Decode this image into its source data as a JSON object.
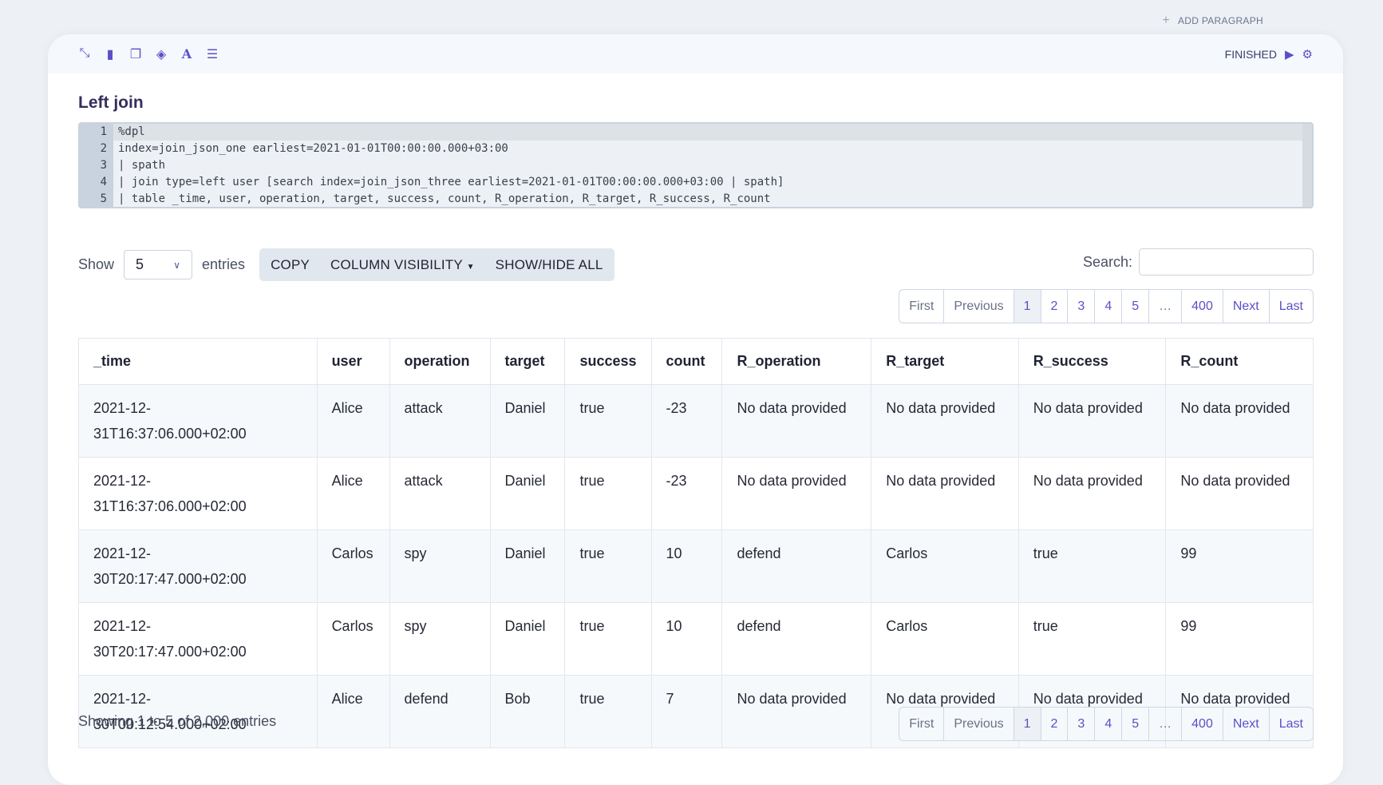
{
  "add_paragraph": "ADD PARAGRAPH",
  "toolbar": {
    "icons": [
      "compress-icon",
      "book-icon",
      "copy-icon",
      "eraser-icon",
      "font-icon",
      "list-ol-icon"
    ],
    "status": "FINISHED"
  },
  "paragraph": {
    "title": "Left join",
    "code": [
      "%dpl",
      "index=join_json_one earliest=2021-01-01T00:00:00.000+03:00",
      "| spath",
      "| join type=left user [search index=join_json_three earliest=2021-01-01T00:00:00.000+03:00 | spath]",
      "| table _time, user, operation, target, success, count, R_operation, R_target, R_success, R_count"
    ]
  },
  "controls": {
    "show": "Show",
    "page_size": "5",
    "entries": "entries",
    "copy": "COPY",
    "column_visibility": "COLUMN VISIBILITY",
    "show_hide_all": "SHOW/HIDE ALL",
    "search_label": "Search:",
    "search_value": ""
  },
  "pagination": {
    "first": "First",
    "previous": "Previous",
    "pages": [
      "1",
      "2",
      "3",
      "4",
      "5"
    ],
    "ellipsis": "…",
    "last_page": "400",
    "next": "Next",
    "last": "Last",
    "current": "1"
  },
  "table": {
    "columns": [
      "_time",
      "user",
      "operation",
      "target",
      "success",
      "count",
      "R_operation",
      "R_target",
      "R_success",
      "R_count"
    ],
    "rows": [
      [
        "2021-12-31T16:37:06.000+02:00",
        "Alice",
        "attack",
        "Daniel",
        "true",
        "-23",
        "No data provided",
        "No data provided",
        "No data provided",
        "No data provided"
      ],
      [
        "2021-12-31T16:37:06.000+02:00",
        "Alice",
        "attack",
        "Daniel",
        "true",
        "-23",
        "No data provided",
        "No data provided",
        "No data provided",
        "No data provided"
      ],
      [
        "2021-12-30T20:17:47.000+02:00",
        "Carlos",
        "spy",
        "Daniel",
        "true",
        "10",
        "defend",
        "Carlos",
        "true",
        "99"
      ],
      [
        "2021-12-30T20:17:47.000+02:00",
        "Carlos",
        "spy",
        "Daniel",
        "true",
        "10",
        "defend",
        "Carlos",
        "true",
        "99"
      ],
      [
        "2021-12-30T00:12:54.000+02:00",
        "Alice",
        "defend",
        "Bob",
        "true",
        "7",
        "No data provided",
        "No data provided",
        "No data provided",
        "No data provided"
      ]
    ]
  },
  "info": "Showing 1 to 5 of 2,000 entries"
}
